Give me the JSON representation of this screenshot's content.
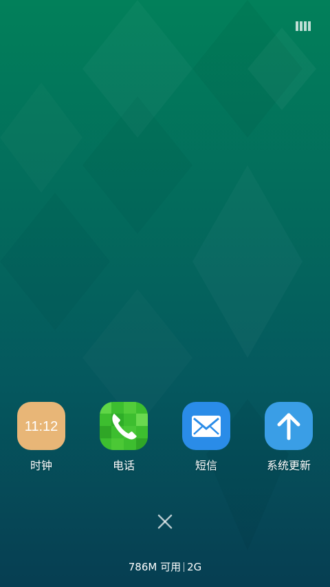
{
  "colors": {
    "background_top": "#02805a",
    "background_bottom": "#063e52",
    "clock_icon_bg": "#e8b677",
    "phone_icon_bg": "#3dbe2f",
    "sms_icon_bg": "#2a8ce8",
    "update_icon_bg": "#3a9ee6"
  },
  "top_icon": "recent-apps-grid-icon",
  "recent_apps": [
    {
      "label": "时钟",
      "icon": "clock-icon",
      "icon_text": "11:12"
    },
    {
      "label": "电话",
      "icon": "phone-icon"
    },
    {
      "label": "短信",
      "icon": "sms-icon"
    },
    {
      "label": "系统更新",
      "icon": "system-update-icon"
    }
  ],
  "close_icon": "close-icon",
  "memory": {
    "available": "786M 可用",
    "total": "2G"
  }
}
